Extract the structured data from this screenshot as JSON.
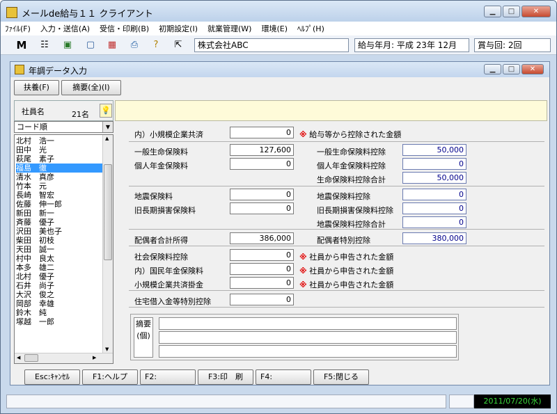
{
  "app": {
    "title": "メールde給与１１ クライアント"
  },
  "menu": [
    "ﾌｧｲﾙ(F)",
    "入力・送信(A)",
    "受信・印刷(B)",
    "初期設定(I)",
    "就業管理(W)",
    "環境(E)",
    "ﾍﾙﾌﾟ(H)"
  ],
  "toolbar": {
    "company": "株式会社ABC",
    "pay_month": "給与年月: 平成 23年 12月",
    "bonus": "賞与回: 2回"
  },
  "child": {
    "title": "年調データ入力",
    "btn_fuyo": "扶養(F)",
    "btn_tekiyo": "摘要(全)(I)"
  },
  "list": {
    "header": "社員名",
    "count": "21名",
    "sort": "コード順",
    "items": [
      "北村　浩一",
      "田中　光",
      "萩尾　素子",
      "福島　徹",
      "清水　真彦",
      "竹本　元",
      "長崎　智宏",
      "佐藤　伸一郎",
      "新田　新一",
      "斉藤　優子",
      "沢田　美也子",
      "柴田　初枝",
      "天田　誠一",
      "村中　良太",
      "本多　雄二",
      "北村　優子",
      "石井　尚子",
      "大沢　俊之",
      "岡部　幸雄",
      "鈴木　純",
      "塚越　一郎"
    ],
    "selected_index": 3
  },
  "form": {
    "small_biz_label": "内）小規模企業共済",
    "small_biz_value": "0",
    "note_salary": "給与等から控除された金額",
    "life_ins_label": "一般生命保険料",
    "life_ins_value": "127,600",
    "pension_label": "個人年金保険料",
    "pension_value": "0",
    "life_ded_label": "一般生命保険料控除",
    "life_ded_value": "50,000",
    "pension_ded_label": "個人年金保険料控除",
    "pension_ded_value": "0",
    "life_total_label": "生命保険料控除合計",
    "life_total_value": "50,000",
    "quake_label": "地震保険料",
    "quake_value": "0",
    "old_long_label": "旧長期損害保険料",
    "old_long_value": "0",
    "quake_ded_label": "地震保険料控除",
    "quake_ded_value": "0",
    "old_long_ded_label": "旧長期損害保険料控除",
    "old_long_ded_value": "0",
    "quake_total_label": "地震保険料控除合計",
    "quake_total_value": "0",
    "spouse_income_label": "配偶者合計所得",
    "spouse_income_value": "386,000",
    "spouse_special_label": "配偶者特別控除",
    "spouse_special_value": "380,000",
    "social_label": "社会保険料控除",
    "social_value": "0",
    "national_pension_label": "内）国民年金保険料",
    "national_pension_value": "0",
    "small_biz2_label": "小規模企業共済掛金",
    "small_biz2_value": "0",
    "note_employee": "社員から申告された金額",
    "housing_label": "住宅借入金等特別控除",
    "housing_value": "0",
    "memo_label": "摘要(個)"
  },
  "fkeys": [
    "Esc:ｷｬﾝｾﾙ",
    "F1:ヘルプ",
    "F2:",
    "F3:印　刷",
    "F4:",
    "F5:閉じる"
  ],
  "status": {
    "date": "2011/07/20(水)"
  },
  "colors": {
    "accent": "#3399ff",
    "required_mark": "#e00000",
    "date_text": "#3cdc3c"
  }
}
